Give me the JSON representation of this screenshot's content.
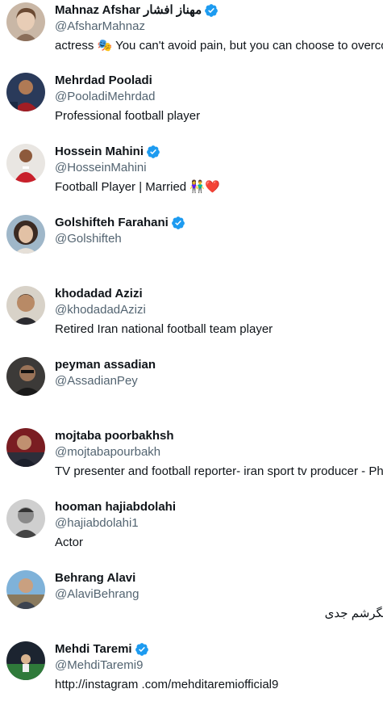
{
  "colors": {
    "verified": "#1d9bf0",
    "secondary_text": "#536471",
    "primary_text": "#0f1419"
  },
  "users": [
    {
      "name": "Mahnaz Afshar",
      "name_rtl": "مهناز افشار",
      "verified": true,
      "handle": "@AfsharMahnaz",
      "bio": "actress 🎭 You can't avoid pain, but you can choose to overco",
      "bio_rtl": false,
      "avatar_icon": "avatar-woman-icon"
    },
    {
      "name": "Mehrdad Pooladi",
      "name_rtl": "",
      "verified": false,
      "handle": "@PooladiMehrdad",
      "bio": "Professional football player",
      "bio_rtl": false,
      "avatar_icon": "avatar-player-icon"
    },
    {
      "name": "Hossein Mahini",
      "name_rtl": "",
      "verified": true,
      "handle": "@HosseinMahini",
      "bio": "Football Player | Married 👫❤️",
      "bio_rtl": false,
      "avatar_icon": "avatar-player-red-icon"
    },
    {
      "name": "Golshifteh Farahani",
      "name_rtl": "",
      "verified": true,
      "handle": "@Golshifteh",
      "bio": "",
      "bio_rtl": false,
      "avatar_icon": "avatar-woman-curly-icon"
    },
    {
      "name": "khodadad Azizi",
      "name_rtl": "",
      "verified": false,
      "handle": "@khodadadAzizi",
      "bio": "Retired Iran national football team player",
      "bio_rtl": false,
      "avatar_icon": "avatar-man-icon"
    },
    {
      "name": "peyman assadian",
      "name_rtl": "",
      "verified": false,
      "handle": "@AssadianPey",
      "bio": "",
      "bio_rtl": false,
      "avatar_icon": "avatar-man-dark-icon"
    },
    {
      "name": "mojtaba poorbakhsh",
      "name_rtl": "",
      "verified": false,
      "handle": "@mojtabapourbakh",
      "bio": "TV presenter and football reporter- iran sport tv producer - Ph",
      "bio_rtl": false,
      "avatar_icon": "avatar-presenter-icon"
    },
    {
      "name": "hooman hajiabdolahi",
      "name_rtl": "",
      "verified": false,
      "handle": "@hajiabdolahi1",
      "bio": "Actor",
      "bio_rtl": false,
      "avatar_icon": "avatar-man-gray-icon"
    },
    {
      "name": "Behrang Alavi",
      "name_rtl": "",
      "verified": false,
      "handle": "@AlaviBehrang",
      "bio": "نگرشم جدی",
      "bio_rtl": true,
      "avatar_icon": "avatar-man-outdoor-icon"
    },
    {
      "name": "Mehdi Taremi",
      "name_rtl": "",
      "verified": true,
      "handle": "@MehdiTaremi9",
      "bio": "http://instagram .com/mehditaremiofficial9",
      "bio_rtl": false,
      "avatar_icon": "avatar-stadium-icon"
    }
  ]
}
